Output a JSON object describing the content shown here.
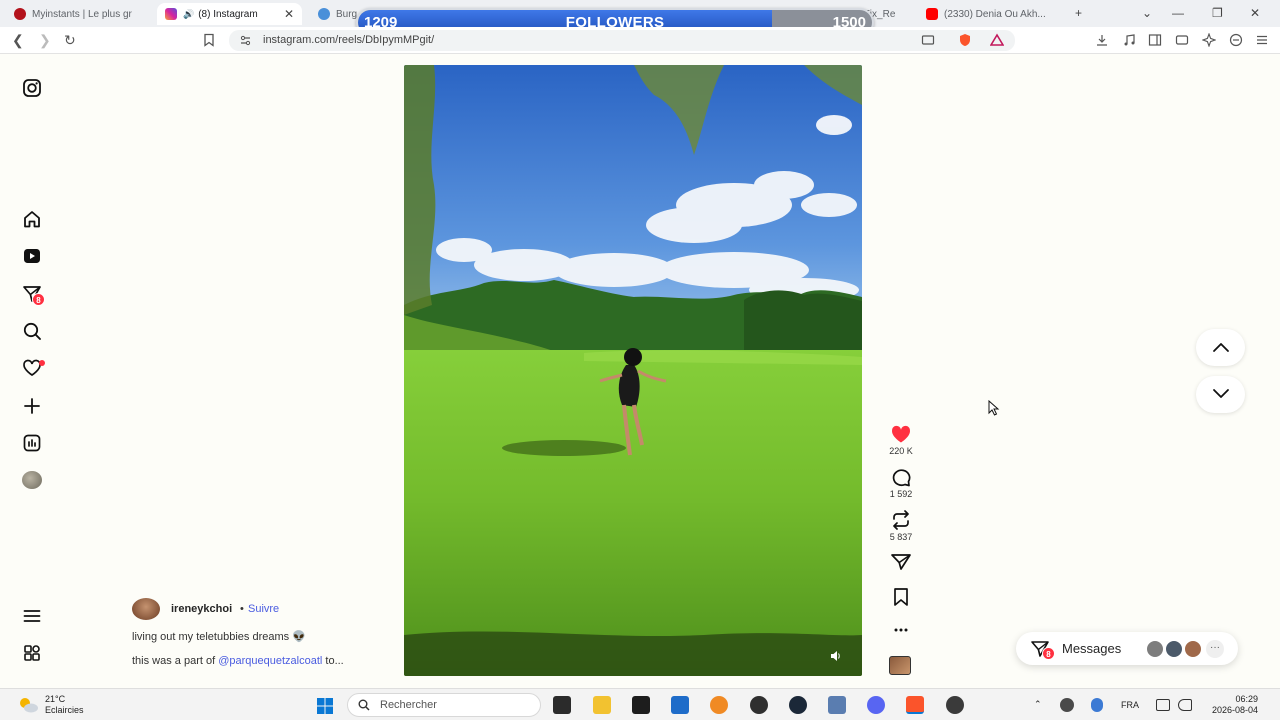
{
  "browser": {
    "tabs": [
      {
        "title": "Myinstants | Le plus gr",
        "favicon_color": "#b3121b"
      },
      {
        "title": "(8) Instagram",
        "favicon_color": "#d6249f",
        "active": true
      },
      {
        "title": "Burg",
        "favicon_color": "#4a90d9"
      },
      {
        "title": "BurglinGnomes Fix_Re",
        "favicon_color": "#333333"
      },
      {
        "title": "(2330) Denia Ou Akh...",
        "favicon_color": "#ff0000"
      }
    ],
    "url": "instagram.com/reels/DbIpymMPgit/"
  },
  "followers_overlay": {
    "label": "FOLLOWERS",
    "current": "1209",
    "target": "1500",
    "progress": 0.806
  },
  "ig_nav": {
    "messages_badge": "8"
  },
  "reel": {
    "username": "ireneykchoi",
    "separator": "•",
    "follow_label": "Suivre",
    "caption_line1": "living out my teletubbies dreams 👽",
    "caption_line2_prefix": "this was a part of ",
    "caption_mention": "@parquequetzalcoatl",
    "caption_line2_suffix": " to...",
    "likes": "220 K",
    "comments": "1 592",
    "reposts": "5 837"
  },
  "messages_bar": {
    "label": "Messages",
    "badge": "8"
  },
  "taskbar": {
    "weather_temp": "21°C",
    "weather_desc": "Eclaircies",
    "search_placeholder": "Rechercher",
    "language": "FRA",
    "time": "06:29",
    "date": "2026-08-04"
  },
  "colors": {
    "accent_blue": "#4a5ce0",
    "like_red": "#ff3040",
    "overlay_fill": "#2f63d8"
  }
}
